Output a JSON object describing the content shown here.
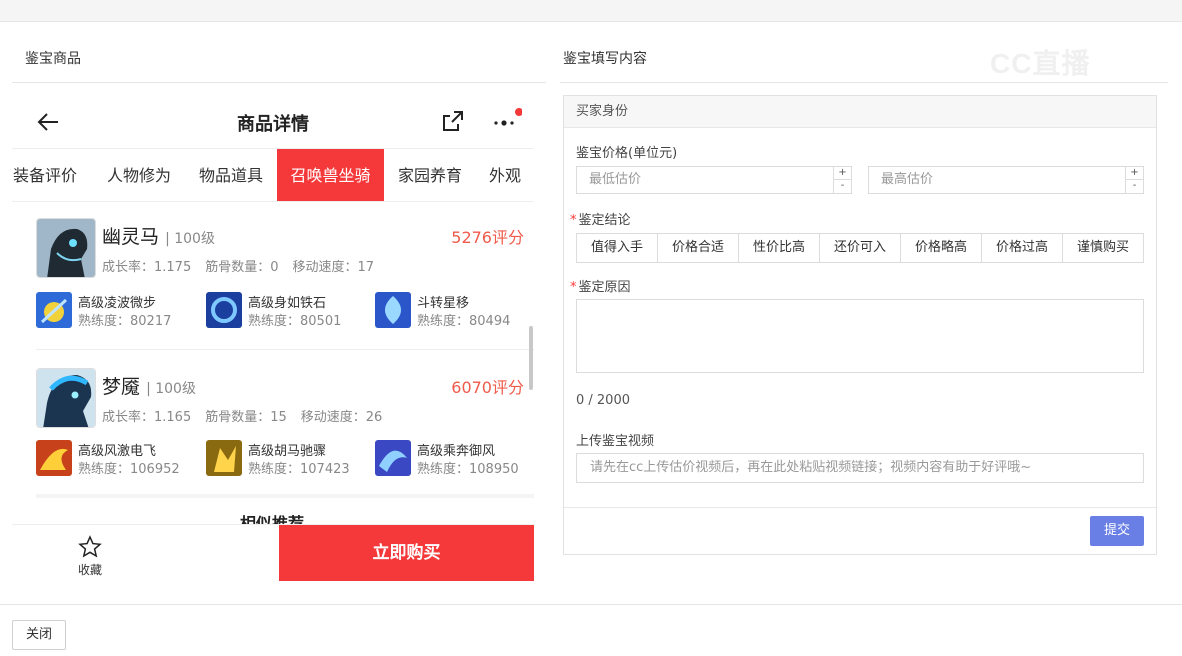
{
  "left_title": "鉴宝商品",
  "right_title": "鉴宝填写内容",
  "watermark": "CC直播",
  "phone": {
    "nav_title": "商品详情",
    "tabs": [
      "装备评价",
      "人物修为",
      "物品道具",
      "召唤兽坐骑",
      "家园养育",
      "外观"
    ],
    "active_tab": "召唤兽坐骑",
    "pets": [
      {
        "name": "幽灵马",
        "level": "| 100级",
        "score": "5276评分",
        "growth": "成长率：1.175",
        "bones": "筋骨数量：0",
        "speed": "移动速度：17",
        "skills": [
          {
            "name": "高级凌波微步",
            "value": "熟练度：80217"
          },
          {
            "name": "高级身如铁石",
            "value": "熟练度：80501"
          },
          {
            "name": "斗转星移",
            "value": "熟练度：80494"
          }
        ]
      },
      {
        "name": "梦魇",
        "level": "| 100级",
        "score": "6070评分",
        "growth": "成长率：1.165",
        "bones": "筋骨数量：15",
        "speed": "移动速度：26",
        "skills": [
          {
            "name": "高级风激电飞",
            "value": "熟练度：106952"
          },
          {
            "name": "高级胡马驰骤",
            "value": "熟练度：107423"
          },
          {
            "name": "高级乘奔御风",
            "value": "熟练度：108950"
          }
        ]
      }
    ],
    "similar": "相似推荐",
    "fav_label": "收藏",
    "buy_label": "立即购买"
  },
  "form": {
    "header": "买家身份",
    "price_label": "鉴宝价格(单位元)",
    "min_placeholder": "最低估价",
    "max_placeholder": "最高估价",
    "conclusion_label": "鉴定结论",
    "conclusions": [
      "值得入手",
      "价格合适",
      "性价比高",
      "还价可入",
      "价格略高",
      "价格过高",
      "谨慎购买"
    ],
    "reason_label": "鉴定原因",
    "counter": "0 / 2000",
    "video_label": "上传鉴宝视频",
    "video_placeholder": "请先在cc上传估价视频后，再在此处粘贴视频链接；视频内容有助于好评哦~",
    "submit_label": "提交"
  },
  "close_label": "关闭",
  "colors": {
    "accent_red": "#f5393b",
    "score_red": "#f05a4a",
    "submit_blue": "#6a7fe6"
  }
}
